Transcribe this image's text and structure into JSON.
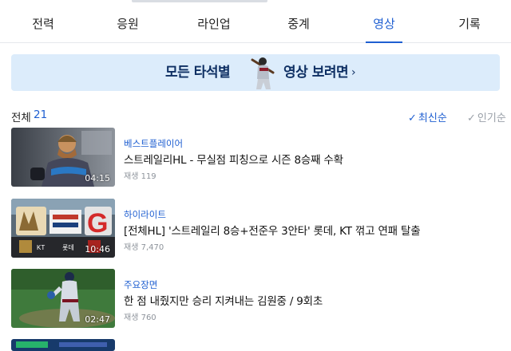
{
  "tabs": [
    {
      "label": "전력"
    },
    {
      "label": "응원"
    },
    {
      "label": "라인업"
    },
    {
      "label": "중계"
    },
    {
      "label": "영상",
      "active": true
    },
    {
      "label": "기록"
    }
  ],
  "banner": {
    "text_left": "모든 타석별",
    "text_right": "영상 보려면",
    "chevron": "›"
  },
  "list": {
    "count_label": "전체",
    "count": "21",
    "sort_options": [
      {
        "label": "최신순",
        "selected": true
      },
      {
        "label": "인기순",
        "selected": false
      }
    ]
  },
  "videos": [
    {
      "category": "베스트플레이어",
      "title": "스트레일리HL - 무실점 피칭으로 시즌 8승째 수확",
      "views": "재생 119",
      "duration": "04:15"
    },
    {
      "category": "하이라이트",
      "title": "[전체HL] '스트레일리 8승+전준우 3안타' 롯데, KT 꺾고 연패 탈출",
      "views": "재생 7,470",
      "duration": "10:46"
    },
    {
      "category": "주요장면",
      "title": "한 점 내줬지만 승리 지켜내는 김원중 / 9회초",
      "views": "재생 760",
      "duration": "02:47"
    }
  ],
  "colors": {
    "accent": "#1f5fd1",
    "banner_bg": "#dcecfb",
    "banner_text": "#0e2f63"
  }
}
